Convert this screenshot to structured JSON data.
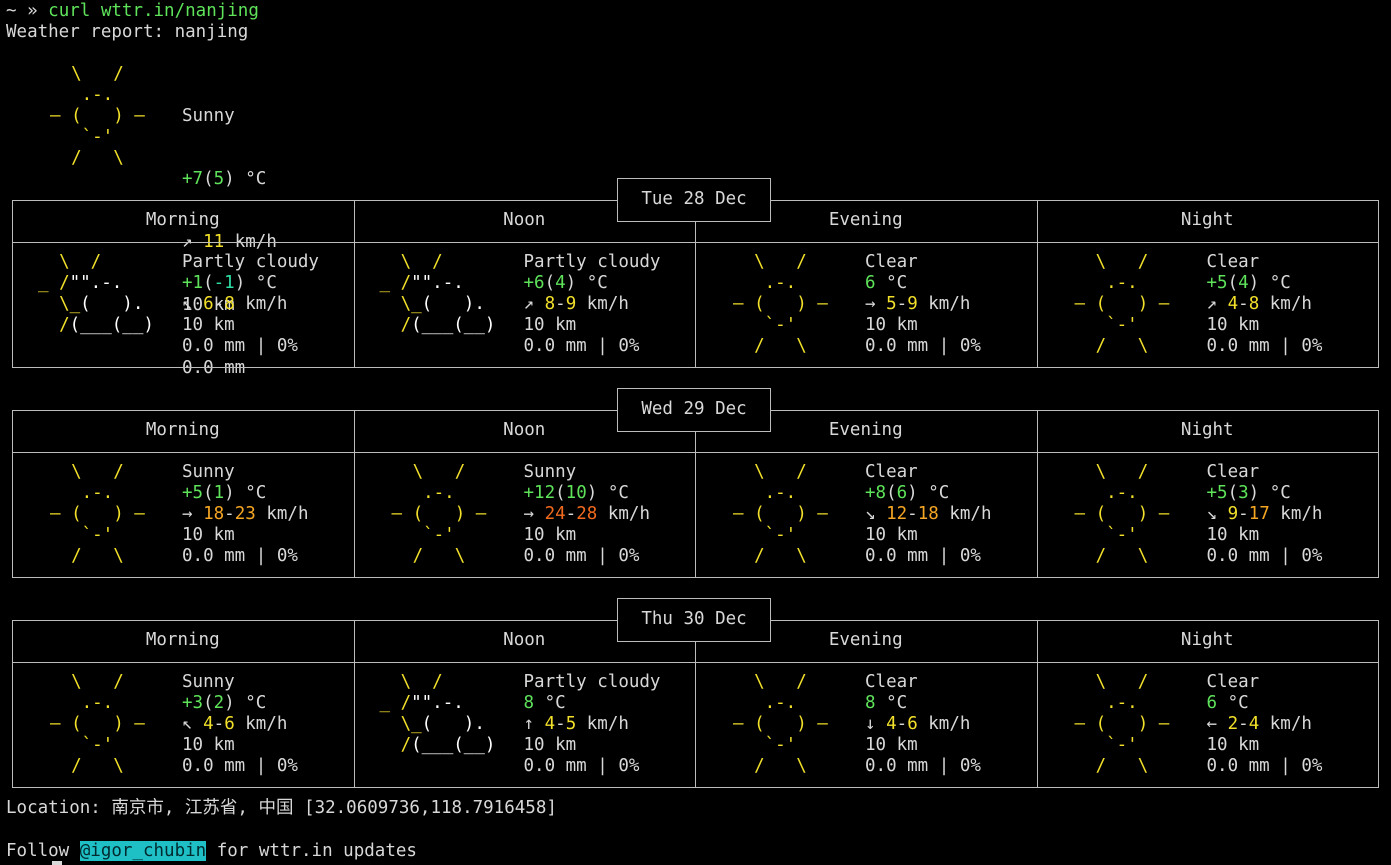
{
  "prompt": {
    "symbol": "~ »",
    "command": "curl wttr.in/nanjing"
  },
  "header": "Weather report: nanjing",
  "current": {
    "condition": "Sunny",
    "temp": "+7",
    "feels": "5",
    "unit": "°C",
    "wind_arrow": "↗",
    "wind": "11",
    "wind_unit": "km/h",
    "visibility": "10 km",
    "precip": "0.0 mm",
    "icon": "sun-icon"
  },
  "periods": [
    "Morning",
    "Noon",
    "Evening",
    "Night"
  ],
  "days": [
    {
      "date": "Tue 28 Dec",
      "slots": [
        {
          "icon": "partly-cloudy-icon",
          "condition": "Partly cloudy",
          "temp": "+1",
          "feels": "-1",
          "wind_arrow": "↖",
          "wind_lo": "6",
          "wind_hi": "8",
          "vis": "10 km",
          "rain": "0.0 mm | 0%"
        },
        {
          "icon": "partly-cloudy-icon",
          "condition": "Partly cloudy",
          "temp": "+6",
          "feels": "4",
          "wind_arrow": "↗",
          "wind_lo": "8",
          "wind_hi": "9",
          "vis": "10 km",
          "rain": "0.0 mm | 0%"
        },
        {
          "icon": "sun-icon",
          "condition": "Clear",
          "temp": "6",
          "feels": "",
          "wind_arrow": "→",
          "wind_lo": "5",
          "wind_hi": "9",
          "vis": "10 km",
          "rain": "0.0 mm | 0%"
        },
        {
          "icon": "sun-icon",
          "condition": "Clear",
          "temp": "+5",
          "feels": "4",
          "wind_arrow": "↗",
          "wind_lo": "4",
          "wind_hi": "8",
          "vis": "10 km",
          "rain": "0.0 mm | 0%"
        }
      ]
    },
    {
      "date": "Wed 29 Dec",
      "slots": [
        {
          "icon": "sun-icon",
          "condition": "Sunny",
          "temp": "+5",
          "feels": "1",
          "wind_arrow": "→",
          "wind_lo": "18",
          "wind_hi": "23",
          "vis": "10 km",
          "rain": "0.0 mm | 0%"
        },
        {
          "icon": "sun-icon",
          "condition": "Sunny",
          "temp": "+12",
          "feels": "10",
          "wind_arrow": "→",
          "wind_lo": "24",
          "wind_hi": "28",
          "vis": "10 km",
          "rain": "0.0 mm | 0%"
        },
        {
          "icon": "sun-icon",
          "condition": "Clear",
          "temp": "+8",
          "feels": "6",
          "wind_arrow": "↘",
          "wind_lo": "12",
          "wind_hi": "18",
          "vis": "10 km",
          "rain": "0.0 mm | 0%"
        },
        {
          "icon": "sun-icon",
          "condition": "Clear",
          "temp": "+5",
          "feels": "3",
          "wind_arrow": "↘",
          "wind_lo": "9",
          "wind_hi": "17",
          "vis": "10 km",
          "rain": "0.0 mm | 0%"
        }
      ]
    },
    {
      "date": "Thu 30 Dec",
      "slots": [
        {
          "icon": "sun-icon",
          "condition": "Sunny",
          "temp": "+3",
          "feels": "2",
          "wind_arrow": "↖",
          "wind_lo": "4",
          "wind_hi": "6",
          "vis": "10 km",
          "rain": "0.0 mm | 0%"
        },
        {
          "icon": "partly-cloudy-icon",
          "condition": "Partly cloudy",
          "temp": "8",
          "feels": "",
          "wind_arrow": "↑",
          "wind_lo": "4",
          "wind_hi": "5",
          "vis": "10 km",
          "rain": "0.0 mm | 0%"
        },
        {
          "icon": "sun-icon",
          "condition": "Clear",
          "temp": "8",
          "feels": "",
          "wind_arrow": "↓",
          "wind_lo": "4",
          "wind_hi": "6",
          "vis": "10 km",
          "rain": "0.0 mm | 0%"
        },
        {
          "icon": "sun-icon",
          "condition": "Clear",
          "temp": "6",
          "feels": "",
          "wind_arrow": "←",
          "wind_lo": "2",
          "wind_hi": "4",
          "vis": "10 km",
          "rain": "0.0 mm | 0%"
        }
      ]
    }
  ],
  "location": "Location: 南京市, 江苏省, 中国 [32.0609736,118.7916458]",
  "footer": {
    "prefix": "Follow ",
    "handle": "@igor_chubin",
    "suffix": " for wttr.in updates"
  },
  "colors": {
    "sun": "#f2e02a",
    "temp": "#5ee35a",
    "feels_neg": "#2ee0a6",
    "wind_low": "#f2e02a",
    "wind_mid": "#f5a623",
    "wind_high": "#f06a1e",
    "handle_bg": "#1ec0c6"
  }
}
